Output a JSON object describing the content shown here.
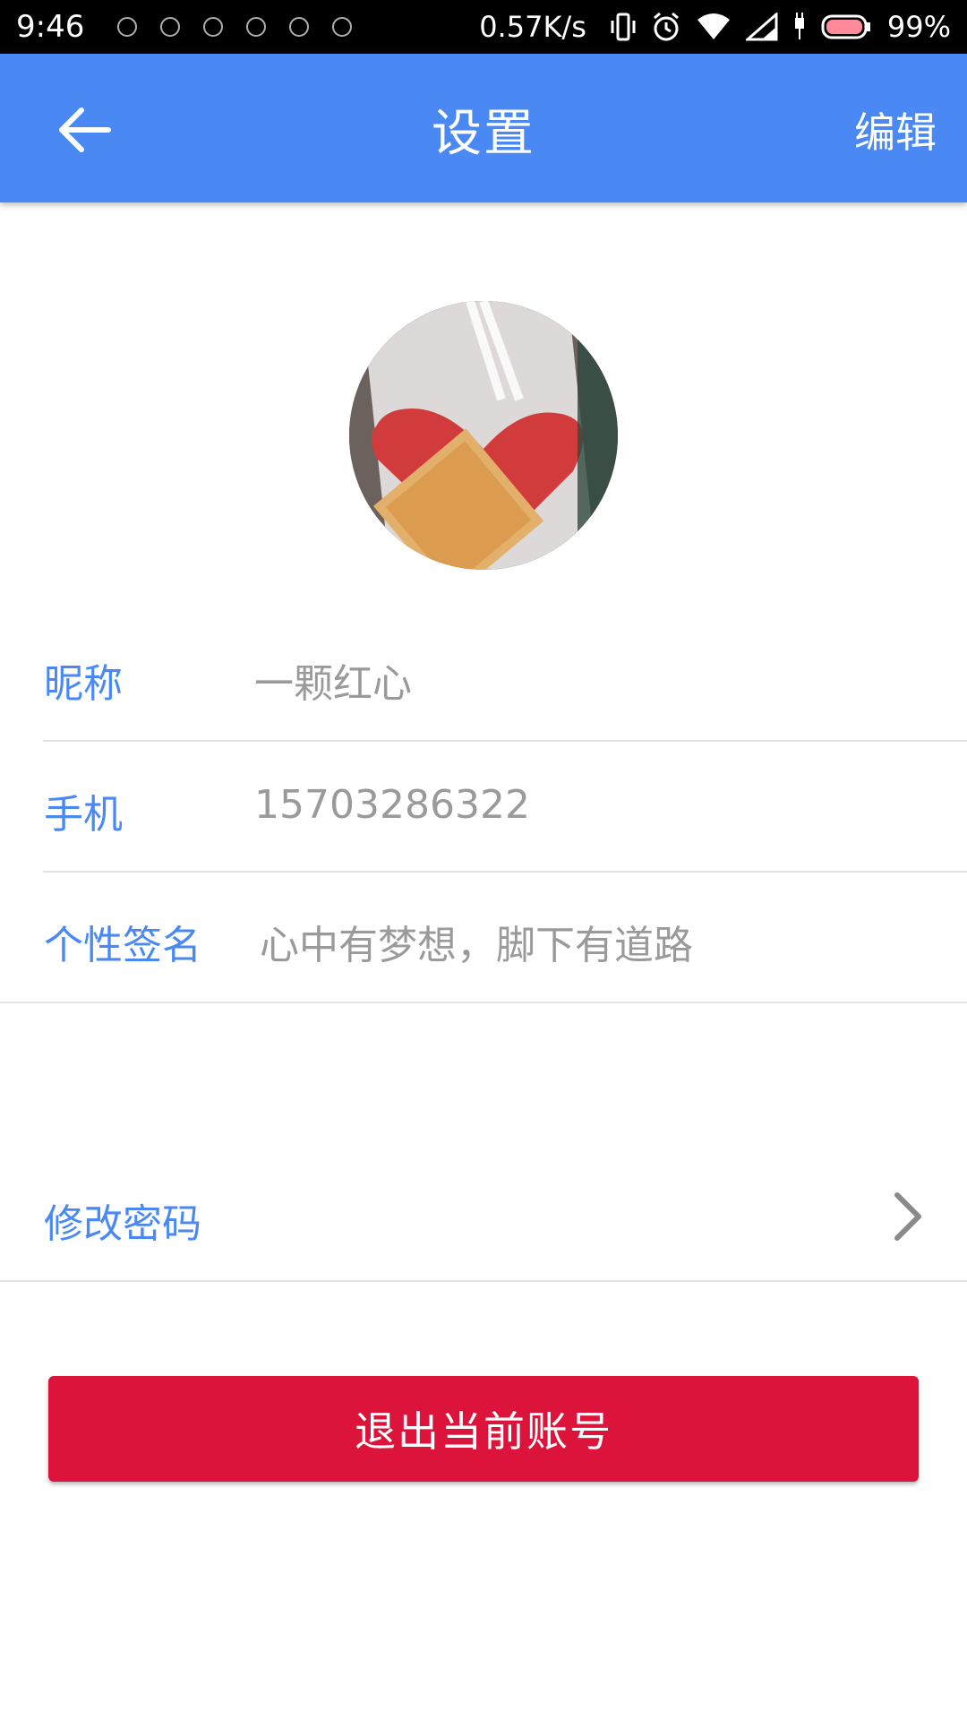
{
  "status_bar": {
    "time": "9:46",
    "net_speed": "0.57K/s",
    "battery": "99%",
    "notification_icons": [
      "app-icon",
      "app-icon",
      "qq-icon",
      "app-icon",
      "app-icon",
      "app-icon"
    ]
  },
  "app_bar": {
    "title": "设置",
    "edit_label": "编辑",
    "background": "#4A89F3"
  },
  "profile": {
    "nickname_label": "昵称",
    "nickname_value": "一颗红心",
    "phone_label": "手机",
    "phone_value": "15703286322",
    "signature_label": "个性签名",
    "signature_value": "心中有梦想，脚下有道路"
  },
  "settings": {
    "change_password_label": "修改密码"
  },
  "logout": {
    "label": "退出当前账号",
    "color": "#DC143C"
  }
}
